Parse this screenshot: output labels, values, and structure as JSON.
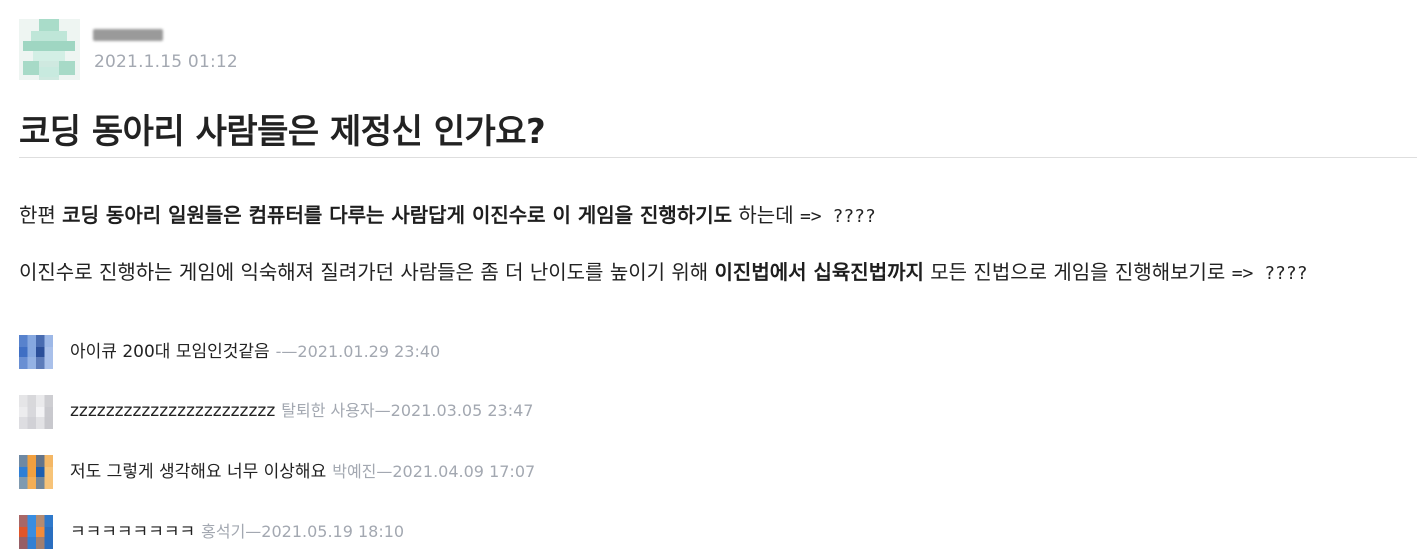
{
  "post": {
    "author_date": "2021.1.15 01:12",
    "title": "코딩 동아리 사람들은 제정신 인가요?",
    "para1": {
      "pre": "한편 ",
      "bold": "코딩 동아리 일원들은 컴퓨터를 다루는 사람답게 이진수로 이 게임을 진행하기도",
      "post": " 하는데 ",
      "arrow": "=> ????"
    },
    "para2": {
      "pre": "이진수로 진행하는 게임에 익숙해져 질려가던 사람들은 좀 더 난이도를 높이기 위해 ",
      "bold": "이진법에서 십육진법까지",
      "post": " 모든 진법으로 게임을 진행해보기로 ",
      "arrow": "=> ????"
    }
  },
  "comments": [
    {
      "text": "아이큐 200대 모임인것같음",
      "meta": "-—2021.01.29 23:40",
      "avatar_colors": [
        "#3f6fc4",
        "#86a8e0",
        "#2b4f9a",
        "#a9c0ea"
      ]
    },
    {
      "text": "zzzzzzzzzzzzzzzzzzzzzzz",
      "meta": "탈퇴한 사용자—2021.03.05 23:47",
      "avatar_colors": [
        "#ececee",
        "#d8d8dc",
        "#f3f3f5",
        "#c9c9ce"
      ]
    },
    {
      "text": "저도 그렇게 생각해요 너무 이상해요",
      "meta": "박예진—2021.04.09 17:07",
      "avatar_colors": [
        "#2f7fd6",
        "#f0a040",
        "#1d5fb0",
        "#f7c478"
      ]
    },
    {
      "text": "ㅋㅋㅋㅋㅋㅋㅋㅋ",
      "meta": "홍석기—2021.05.19 18:10",
      "avatar_colors": [
        "#e0552a",
        "#3a8de0",
        "#f28b3a",
        "#2a6fc0"
      ]
    }
  ]
}
